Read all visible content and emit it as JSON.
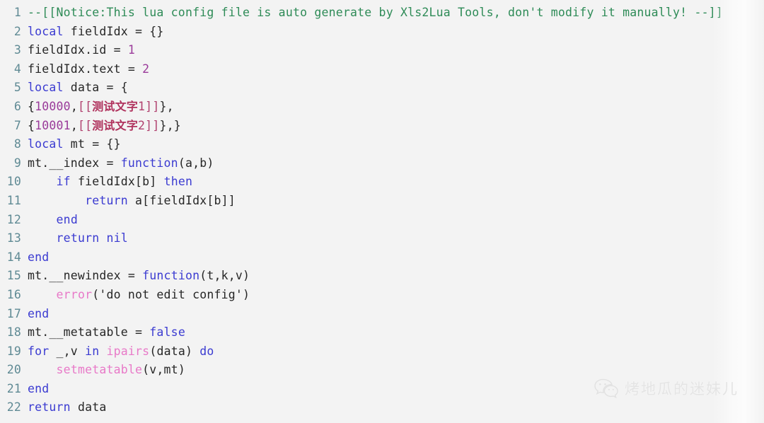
{
  "editor": {
    "language": "lua",
    "background_color": "#f3f3f3",
    "line_number_color": "#5f8a94",
    "total_lines": 22,
    "colors": {
      "comment": "#2e8b57",
      "keyword": "#3b3bd1",
      "builtin": "#e879c8",
      "number": "#9a3a9a",
      "string": "#b0406e",
      "text": "#262626"
    }
  },
  "lines": [
    {
      "n": "1",
      "tokens": [
        {
          "t": "comment",
          "s": "--[[Notice:This lua config file is auto generate by Xls2Lua Tools, don't modify it manually! --]]"
        }
      ]
    },
    {
      "n": "2",
      "tokens": [
        {
          "t": "keyword",
          "s": "local"
        },
        {
          "t": "plain",
          "s": " fieldIdx = {}"
        }
      ]
    },
    {
      "n": "3",
      "tokens": [
        {
          "t": "plain",
          "s": "fieldIdx.id = "
        },
        {
          "t": "number",
          "s": "1"
        }
      ]
    },
    {
      "n": "4",
      "tokens": [
        {
          "t": "plain",
          "s": "fieldIdx.text = "
        },
        {
          "t": "number",
          "s": "2"
        }
      ]
    },
    {
      "n": "5",
      "tokens": [
        {
          "t": "keyword",
          "s": "local"
        },
        {
          "t": "plain",
          "s": " data = {"
        }
      ]
    },
    {
      "n": "6",
      "tokens": [
        {
          "t": "plain",
          "s": "{"
        },
        {
          "t": "number",
          "s": "10000"
        },
        {
          "t": "plain",
          "s": ","
        },
        {
          "t": "string",
          "s": "[["
        },
        {
          "t": "cjk",
          "s": "测试文字"
        },
        {
          "t": "string",
          "s": "1]]"
        },
        {
          "t": "plain",
          "s": "},"
        }
      ]
    },
    {
      "n": "7",
      "tokens": [
        {
          "t": "plain",
          "s": "{"
        },
        {
          "t": "number",
          "s": "10001"
        },
        {
          "t": "plain",
          "s": ","
        },
        {
          "t": "string",
          "s": "[["
        },
        {
          "t": "cjk",
          "s": "测试文字"
        },
        {
          "t": "string",
          "s": "2]]"
        },
        {
          "t": "plain",
          "s": "},}"
        }
      ]
    },
    {
      "n": "8",
      "tokens": [
        {
          "t": "keyword",
          "s": "local"
        },
        {
          "t": "plain",
          "s": " mt = {}"
        }
      ]
    },
    {
      "n": "9",
      "tokens": [
        {
          "t": "plain",
          "s": "mt.__index = "
        },
        {
          "t": "keyword",
          "s": "function"
        },
        {
          "t": "plain",
          "s": "(a,b)"
        }
      ]
    },
    {
      "n": "10",
      "tokens": [
        {
          "t": "plain",
          "s": "    "
        },
        {
          "t": "keyword",
          "s": "if"
        },
        {
          "t": "plain",
          "s": " fieldIdx[b] "
        },
        {
          "t": "keyword",
          "s": "then"
        }
      ]
    },
    {
      "n": "11",
      "tokens": [
        {
          "t": "plain",
          "s": "        "
        },
        {
          "t": "keyword",
          "s": "return"
        },
        {
          "t": "plain",
          "s": " a[fieldIdx[b]]"
        }
      ]
    },
    {
      "n": "12",
      "tokens": [
        {
          "t": "plain",
          "s": "    "
        },
        {
          "t": "keyword",
          "s": "end"
        }
      ]
    },
    {
      "n": "13",
      "tokens": [
        {
          "t": "plain",
          "s": "    "
        },
        {
          "t": "keyword",
          "s": "return"
        },
        {
          "t": "plain",
          "s": " "
        },
        {
          "t": "keyword",
          "s": "nil"
        }
      ]
    },
    {
      "n": "14",
      "tokens": [
        {
          "t": "keyword",
          "s": "end"
        }
      ]
    },
    {
      "n": "15",
      "tokens": [
        {
          "t": "plain",
          "s": "mt.__newindex = "
        },
        {
          "t": "keyword",
          "s": "function"
        },
        {
          "t": "plain",
          "s": "(t,k,v)"
        }
      ]
    },
    {
      "n": "16",
      "tokens": [
        {
          "t": "plain",
          "s": "    "
        },
        {
          "t": "builtin",
          "s": "error"
        },
        {
          "t": "plain",
          "s": "('do not edit config')"
        }
      ]
    },
    {
      "n": "17",
      "tokens": [
        {
          "t": "keyword",
          "s": "end"
        }
      ]
    },
    {
      "n": "18",
      "tokens": [
        {
          "t": "plain",
          "s": "mt.__metatable = "
        },
        {
          "t": "keyword",
          "s": "false"
        }
      ]
    },
    {
      "n": "19",
      "tokens": [
        {
          "t": "keyword",
          "s": "for"
        },
        {
          "t": "plain",
          "s": " _,v "
        },
        {
          "t": "keyword",
          "s": "in"
        },
        {
          "t": "plain",
          "s": " "
        },
        {
          "t": "builtin",
          "s": "ipairs"
        },
        {
          "t": "plain",
          "s": "(data) "
        },
        {
          "t": "keyword",
          "s": "do"
        }
      ]
    },
    {
      "n": "20",
      "tokens": [
        {
          "t": "plain",
          "s": "    "
        },
        {
          "t": "builtin",
          "s": "setmetatable"
        },
        {
          "t": "plain",
          "s": "(v,mt)"
        }
      ]
    },
    {
      "n": "21",
      "tokens": [
        {
          "t": "keyword",
          "s": "end"
        }
      ]
    },
    {
      "n": "22",
      "tokens": [
        {
          "t": "keyword",
          "s": "return"
        },
        {
          "t": "plain",
          "s": " data"
        }
      ]
    }
  ],
  "watermark": {
    "icon": "wechat-icon",
    "text": "烤地瓜的迷妹儿",
    "color": "#e3e3e3"
  }
}
